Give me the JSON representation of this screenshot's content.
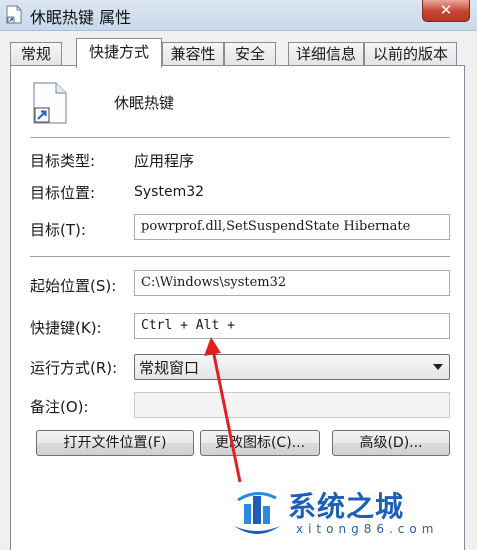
{
  "window": {
    "title": "休眠热键 属性",
    "close_label": "✕"
  },
  "tabs": [
    {
      "label": "常规"
    },
    {
      "label": "快捷方式"
    },
    {
      "label": "兼容性"
    },
    {
      "label": "安全"
    },
    {
      "label": "详细信息"
    },
    {
      "label": "以前的版本"
    }
  ],
  "shortcut": {
    "name": "休眠热键",
    "target_type_label": "目标类型:",
    "target_type_value": "应用程序",
    "target_location_label": "目标位置:",
    "target_location_value": "System32",
    "target_label": "目标(T):",
    "target_value": "powrprof.dll,SetSuspendState Hibernate",
    "start_in_label": "起始位置(S):",
    "start_in_value": "C:\\Windows\\system32",
    "hotkey_label": "快捷键(K):",
    "hotkey_value": "Ctrl + Alt +",
    "run_label": "运行方式(R):",
    "run_value": "常规窗口",
    "comment_label": "备注(O):",
    "comment_value": ""
  },
  "buttons": {
    "open_location": "打开文件位置(F)",
    "change_icon": "更改图标(C)...",
    "advanced": "高级(D)..."
  },
  "watermark": {
    "title": "系统之城",
    "domain": "xitong86.com"
  },
  "colors": {
    "arrow": "#e02020",
    "watermark": "#1b5fb6"
  }
}
